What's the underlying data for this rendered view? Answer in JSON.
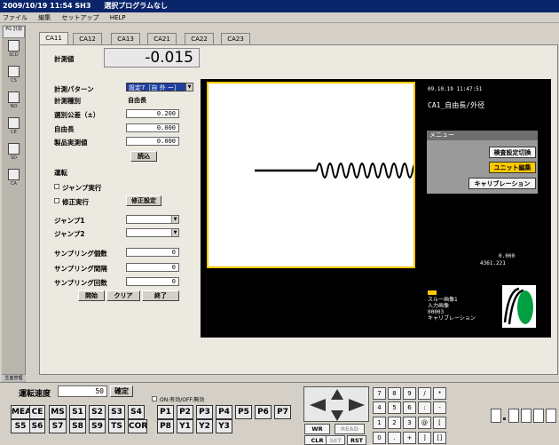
{
  "titlebar": {
    "datetime": "2009/10/19 11:54 SH3",
    "program": "選択プログラムなし"
  },
  "menubar": {
    "items": [
      "ファイル",
      "編集",
      "セットアップ",
      "HELP"
    ]
  },
  "sidebar": {
    "top_label": "PG 計測",
    "items": [
      "SCD",
      "CS",
      "NO",
      "CE",
      "SD",
      "CA"
    ],
    "bottom_label": "生産管理"
  },
  "tabs": [
    "CA11",
    "CA12",
    "CA13",
    "CA21",
    "CA22",
    "CA23"
  ],
  "form": {
    "measure_label": "計測値",
    "measure_value": "-0.015",
    "pattern_label": "計測パターン",
    "pattern_value": "設定7［自 外 ー］",
    "type_label": "計測種別",
    "type_value": "自由長",
    "tolerance_label": "選別公差（±）",
    "tolerance_value": "0.200",
    "free_length_label": "自由長",
    "free_length_value": "0.000",
    "product_label": "製品実測値",
    "product_value": "0.000",
    "read_button": "読込",
    "run_label": "運転",
    "jump_exec_label": "ジャンプ実行",
    "correct_exec_label": "修正実行",
    "correct_setting_button": "修正設定",
    "jump1_label": "ジャンプ1",
    "jump2_label": "ジャンプ2",
    "sampling_count_label": "サンプリング個数",
    "sampling_count_value": "0",
    "sampling_interval_label": "サンプリング間隔",
    "sampling_interval_value": "0",
    "sampling_times_label": "サンプリング回数",
    "sampling_times_value": "0",
    "start_button": "開始",
    "clear_button": "クリア",
    "end_button": "終了"
  },
  "camera": {
    "datetime": "09.10.19  11:47:51",
    "title": "CA1_自由長/外径",
    "menu_title": "メニュー",
    "menu_buttons": [
      "検査設定切換",
      "ユニット編集",
      "キャリブレーション"
    ],
    "reading1": "0.000",
    "reading2": "4361.221",
    "info_lines": [
      "スルー画像1",
      "入力画像",
      "00003",
      "キャリブレーション"
    ]
  },
  "bottom": {
    "speed_label": "運転速度",
    "speed_value": "50",
    "confirm_button": "確定",
    "on_off_label": "ON:有効/OFF:無効",
    "mode_row1": [
      "MEA",
      "CE",
      "MS",
      "S1",
      "S2",
      "S3",
      "S4"
    ],
    "mode_row2": [
      "S5",
      "S6",
      "S7",
      "S8",
      "S9",
      "TS",
      "COR"
    ],
    "p_row1": [
      "P1",
      "P2",
      "P3",
      "P4",
      "P5",
      "P6",
      "P7"
    ],
    "p_row2": [
      "P8",
      "Y1",
      "Y2",
      "Y3"
    ],
    "ctrl_wr": "WR",
    "ctrl_read": "READ",
    "ctrl_clr": "CLR",
    "ctrl_set": "SET",
    "ctrl_rst": "RST",
    "numpad": [
      [
        "7",
        "8",
        "9",
        "/",
        "*"
      ],
      [
        "4",
        "5",
        "6",
        ":",
        "-"
      ],
      [
        "1",
        "2",
        "3",
        "@",
        "["
      ],
      [
        "0",
        ".",
        "+",
        "]",
        "[]"
      ]
    ]
  },
  "colors": {
    "titlebar": "#0a246a",
    "highlight": "#ffc800",
    "camera_bg": "#000000"
  }
}
